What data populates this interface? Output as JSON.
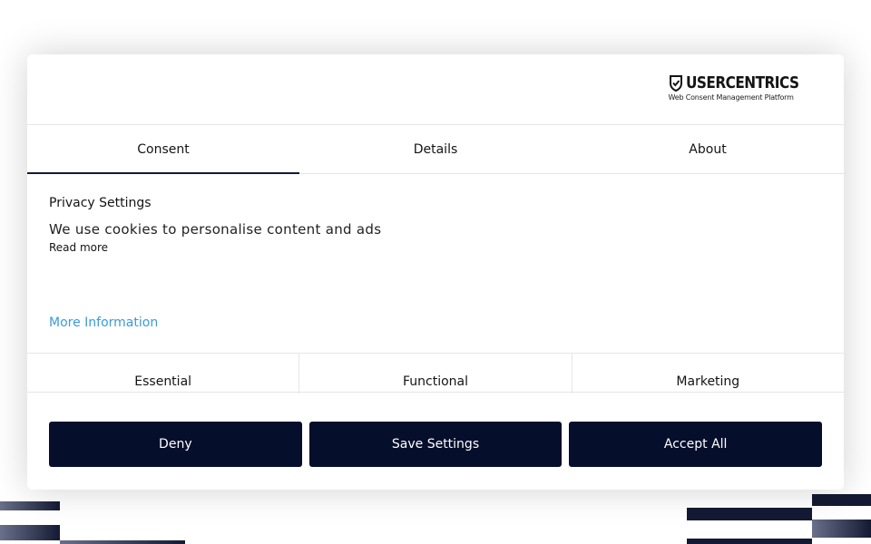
{
  "brand": {
    "name": "USERCENTRICS",
    "tagline": "Web Consent Management Platform",
    "logo_icon": "shield-check-icon"
  },
  "tabs": [
    {
      "label": "Consent",
      "active": true
    },
    {
      "label": "Details",
      "active": false
    },
    {
      "label": "About",
      "active": false
    }
  ],
  "consent": {
    "title": "Privacy Settings",
    "description": "We use cookies to personalise content and ads",
    "read_more": "Read more",
    "more_information": "More Information"
  },
  "categories": [
    "Essential",
    "Functional",
    "Marketing"
  ],
  "buttons": {
    "deny": "Deny",
    "save": "Save Settings",
    "accept": "Accept All"
  },
  "colors": {
    "button_bg": "#050e2b",
    "link": "#3b9bd7",
    "accent": "#141a33"
  }
}
